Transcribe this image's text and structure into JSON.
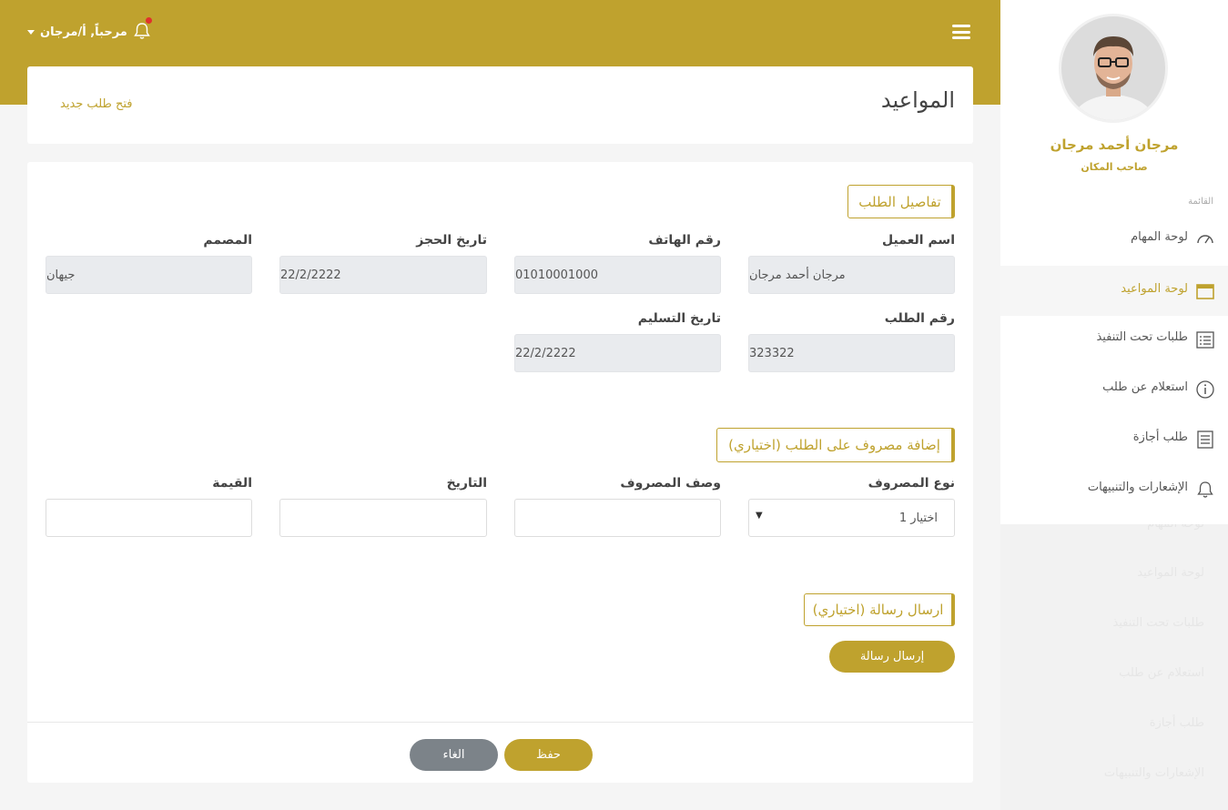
{
  "topbar": {
    "greeting": "مرحباً, أ/مرجان"
  },
  "page": {
    "title": "المواعيد",
    "new_request_link": "فتح طلب جديد"
  },
  "order_details": {
    "section_title": "تفاصيل الطلب",
    "fields": [
      {
        "label": "اسم العميل",
        "value": "مرجان أحمد مرجان"
      },
      {
        "label": "رقم الهاتف",
        "value": "01010001000"
      },
      {
        "label": "تاريخ الحجز",
        "value": "22/2/2222"
      },
      {
        "label": "المصمم",
        "value": "جيهان"
      },
      {
        "label": "رقم الطلب",
        "value": "323322"
      },
      {
        "label": "تاريخ التسليم",
        "value": "22/2/2222"
      }
    ]
  },
  "expense": {
    "section_title": "إضافة مصروف على الطلب (اختياري)",
    "type_label": "نوع المصروف",
    "type_selected": "اختيار 1",
    "description_label": "وصف المصروف",
    "date_label": "التاريخ",
    "value_label": "القيمة"
  },
  "message": {
    "section_title": "ارسال رسالة (اختياري)",
    "send_button": "إرسال رسالة"
  },
  "footer": {
    "save_button": "حفظ",
    "cancel_button": "الغاء"
  },
  "sidebar": {
    "user_name": "مرجان أحمد مرجان",
    "user_role": "صاحب المكان",
    "menu_heading": "القائمة",
    "items": [
      {
        "label": "لوحة المهام",
        "icon": "gauge-icon",
        "active": false
      },
      {
        "label": "لوحة المواعيد",
        "icon": "calendar-icon",
        "active": true
      },
      {
        "label": "طلبات تحت التنفيذ",
        "icon": "list-icon",
        "active": false
      },
      {
        "label": "استعلام عن طلب",
        "icon": "info-icon",
        "active": false
      },
      {
        "label": "طلب أجازة",
        "icon": "document-icon",
        "active": false
      },
      {
        "label": "الإشعارات والتنبيهات",
        "icon": "bell-icon",
        "active": false
      }
    ]
  },
  "colors": {
    "brand_gold": "#bfa22e",
    "cancel_gray": "#7c8389",
    "notification_dot": "#e0312d"
  }
}
